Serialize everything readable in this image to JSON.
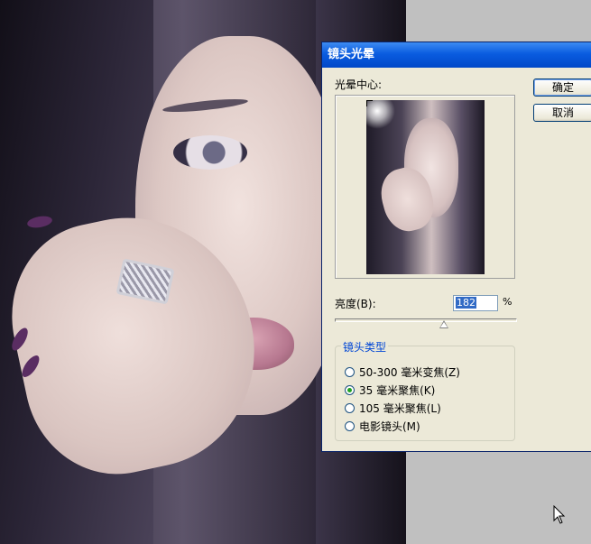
{
  "dialog": {
    "title": "镜头光晕",
    "ok_label": "确定",
    "cancel_label": "取消",
    "flare_center_label": "光晕中心:",
    "brightness_label": "亮度(B):",
    "brightness_value": "182",
    "brightness_unit": "%",
    "brightness_slider_fraction": 0.6,
    "lens_type_label": "镜头类型",
    "lens_options": [
      {
        "label": "50-300 毫米变焦(Z)",
        "selected": false
      },
      {
        "label": "35 毫米聚焦(K)",
        "selected": true
      },
      {
        "label": "105 毫米聚焦(L)",
        "selected": false
      },
      {
        "label": "电影镜头(M)",
        "selected": false
      }
    ]
  },
  "colors": {
    "titlebar": "#0a5ce0",
    "dialog_bg": "#ece9d8",
    "group_label": "#0046d5",
    "selected_radio": "#21a121"
  },
  "icons": {
    "cursor": "arrow-cursor-icon"
  }
}
